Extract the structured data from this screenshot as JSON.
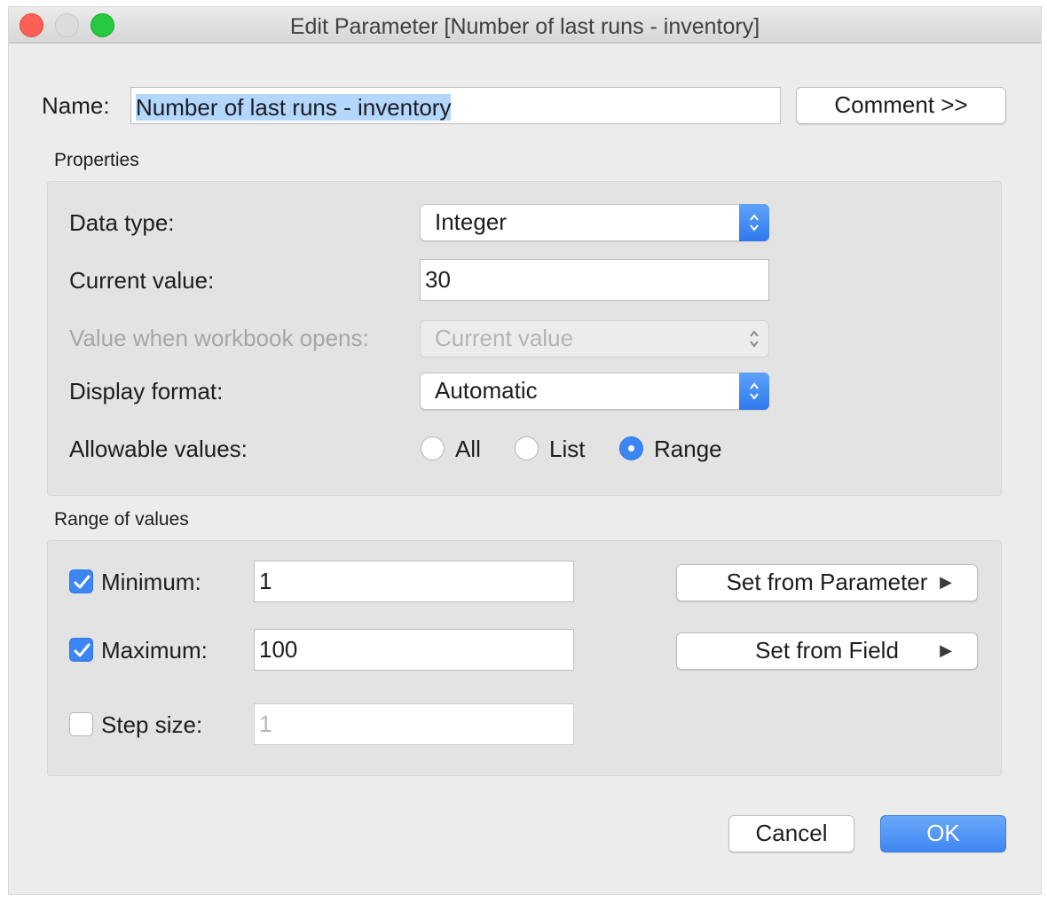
{
  "window": {
    "title": "Edit Parameter [Number of last runs - inventory]"
  },
  "name_row": {
    "label": "Name:",
    "value": "Number of last runs - inventory",
    "comment_button": "Comment >>"
  },
  "properties": {
    "section_title": "Properties",
    "data_type": {
      "label": "Data type:",
      "value": "Integer"
    },
    "current_value": {
      "label": "Current value:",
      "value": "30"
    },
    "workbook_opens": {
      "label": "Value when workbook opens:",
      "value": "Current value"
    },
    "display_format": {
      "label": "Display format:",
      "value": "Automatic"
    },
    "allowable_values": {
      "label": "Allowable values:",
      "options": [
        "All",
        "List",
        "Range"
      ],
      "selected": "Range"
    }
  },
  "range": {
    "section_title": "Range of values",
    "minimum": {
      "label": "Minimum:",
      "value": "1",
      "checked": true
    },
    "maximum": {
      "label": "Maximum:",
      "value": "100",
      "checked": true
    },
    "step_size": {
      "label": "Step size:",
      "value": "1",
      "checked": false
    },
    "set_from_parameter": "Set from Parameter",
    "set_from_field": "Set from Field"
  },
  "footer": {
    "cancel": "Cancel",
    "ok": "OK"
  },
  "colors": {
    "accent": "#3b86f2",
    "selection": "#b3d7ff",
    "close": "#ff5f57",
    "maximize": "#28c840"
  }
}
